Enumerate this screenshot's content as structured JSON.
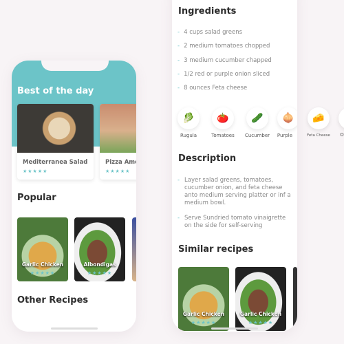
{
  "left_screen": {
    "best_title": "Best of the day",
    "best_cards": [
      {
        "title": "Mediterranea Salad",
        "stars": "★★★★★"
      },
      {
        "title": "Pizza Ame",
        "stars": "★★★★★"
      }
    ],
    "popular_title": "Popular",
    "popular_cards": [
      {
        "title": "Garlic Chicken",
        "stars": "★★★★★"
      },
      {
        "title": "Albondigas",
        "stars": "★★★★★"
      }
    ],
    "other_title": "Other Recipes"
  },
  "right_screen": {
    "ingredients_title": "Ingredients",
    "ingredients": [
      "4 cups salad greens",
      "2 medium tomatoes chopped",
      "3 medium cucumber chapped",
      "1/2 red or purple onion sliced",
      "8 ounces Feta cheese"
    ],
    "ingredient_icons": [
      {
        "label": "Rugula",
        "icon": "🥬"
      },
      {
        "label": "Tomatoes",
        "icon": "🍅"
      },
      {
        "label": "Cucumber",
        "icon": "🥒"
      },
      {
        "label": "Purple",
        "icon": "🧅"
      },
      {
        "label": "Feta Cheese",
        "icon": "🧀"
      },
      {
        "label": "O",
        "icon": ""
      }
    ],
    "description_title": "Description",
    "description": [
      "Layer salad greens, tomatoes, cucumber onion, and feta cheese anto medium serving platter or inf a medium bowl.",
      "Serve Sundried tomato vinaigrette on the side for self-serving"
    ],
    "similar_title": "Similar recipes",
    "similar_cards": [
      {
        "title": "Garlic Chicken",
        "stars": "★★★★★"
      },
      {
        "title": "Garlic Chicken",
        "stars": "★★★★★"
      }
    ]
  },
  "colors": {
    "accent": "#6cc4c8",
    "background": "#f8f4f6",
    "heading": "#2d2d2d"
  },
  "dash": "-"
}
